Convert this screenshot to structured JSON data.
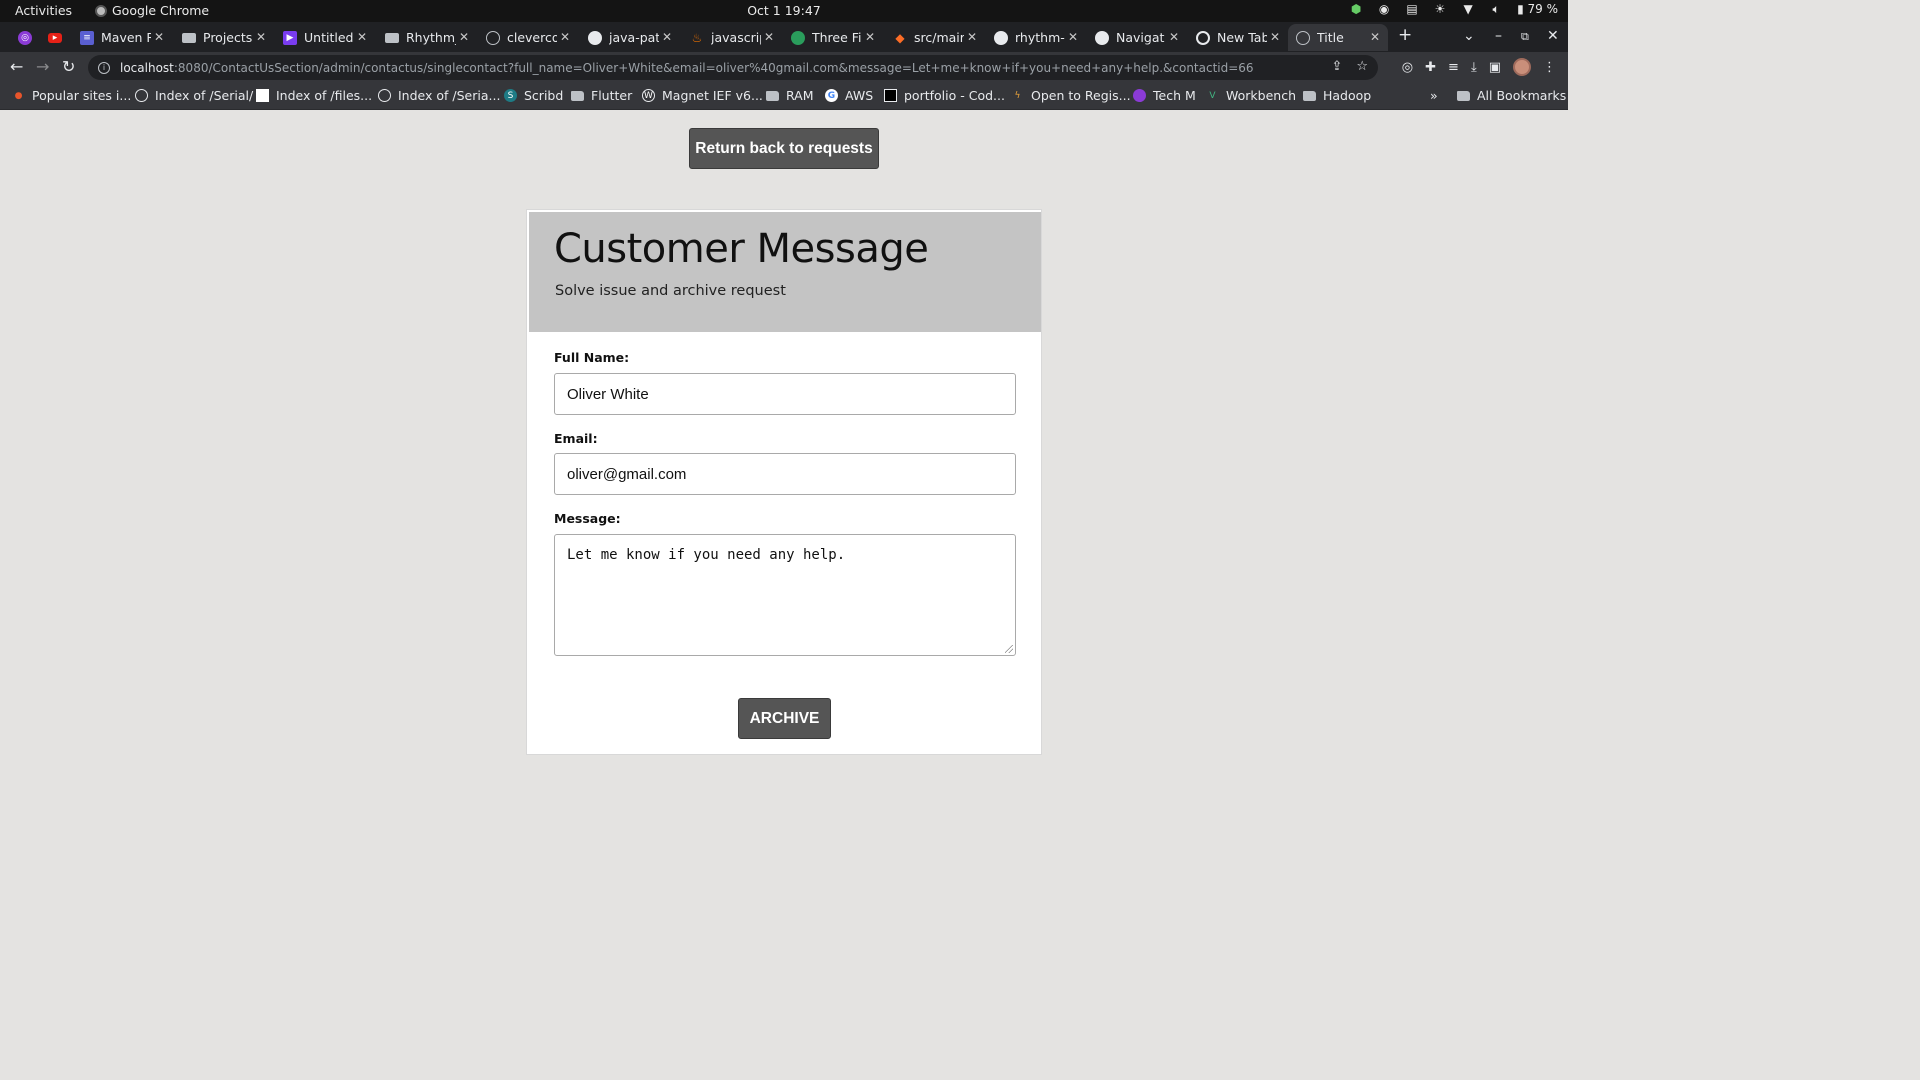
{
  "system_bar": {
    "activities": "Activities",
    "app_name": "Google Chrome",
    "clock": "Oct 1  19:47",
    "battery": "79 %"
  },
  "tabs": [
    {
      "label": "",
      "icon": "tor-icon"
    },
    {
      "label": "",
      "icon": "youtube-icon"
    },
    {
      "label": "Maven R",
      "icon": "maven-icon"
    },
    {
      "label": "Projects",
      "icon": "folder-icon"
    },
    {
      "label": "Untitled",
      "icon": "untitled-icon"
    },
    {
      "label": "Rhythm_",
      "icon": "folder-icon"
    },
    {
      "label": "cleverco",
      "icon": "globe-icon"
    },
    {
      "label": "java-pat",
      "icon": "github-icon"
    },
    {
      "label": "javascrip",
      "icon": "java-icon"
    },
    {
      "label": "Three Fi",
      "icon": "three-icon"
    },
    {
      "label": "src/mair",
      "icon": "gitlab-icon"
    },
    {
      "label": "rhythm-",
      "icon": "github-icon"
    },
    {
      "label": "Navigat",
      "icon": "github-icon"
    },
    {
      "label": "New Tab",
      "icon": "chrome-icon"
    },
    {
      "label": "Title",
      "icon": "globe-icon"
    }
  ],
  "address_bar": {
    "host": "localhost",
    "rest": ":8080/ContactUsSection/admin/contactus/singlecontact?full_name=Oliver+White&email=oliver%40gmail.com&message=Let+me+know+if+you+need+any+help.&contactid=66"
  },
  "bookmarks": [
    {
      "label": "Popular sites i...",
      "icon": "fire-icon"
    },
    {
      "label": "Index of /Serial/",
      "icon": "globe-icon"
    },
    {
      "label": "Index of /files...",
      "icon": "page-icon"
    },
    {
      "label": "Index of /Seria...",
      "icon": "globe-icon"
    },
    {
      "label": "Scribd",
      "icon": "scribd-icon"
    },
    {
      "label": "Flutter",
      "icon": "folder-icon"
    },
    {
      "label": "Magnet IEF v6...",
      "icon": "wordpress-icon"
    },
    {
      "label": "RAM",
      "icon": "folder-icon"
    },
    {
      "label": "AWS",
      "icon": "google-icon"
    },
    {
      "label": "portfolio - Cod...",
      "icon": "codepen-icon"
    },
    {
      "label": "Open to Regis...",
      "icon": "bolt-icon"
    },
    {
      "label": "Tech M",
      "icon": "tor-icon"
    },
    {
      "label": "Workbench",
      "icon": "vue-icon"
    },
    {
      "label": "Hadoop",
      "icon": "folder-icon"
    }
  ],
  "all_bookmarks": "All Bookmarks",
  "page": {
    "return_button": "Return back to requests",
    "title": "Customer Message",
    "subtitle": "Solve issue and archive request",
    "full_name_label": "Full Name:",
    "full_name_value": "Oliver White",
    "email_label": "Email:",
    "email_value": "oliver@gmail.com",
    "message_label": "Message:",
    "message_value": "Let me know if you need any help.",
    "archive_button": "ARCHIVE"
  },
  "colors": {
    "button_bg": "#555555",
    "card_header_bg": "#c4c4c4",
    "page_bg": "#e4e3e1"
  }
}
